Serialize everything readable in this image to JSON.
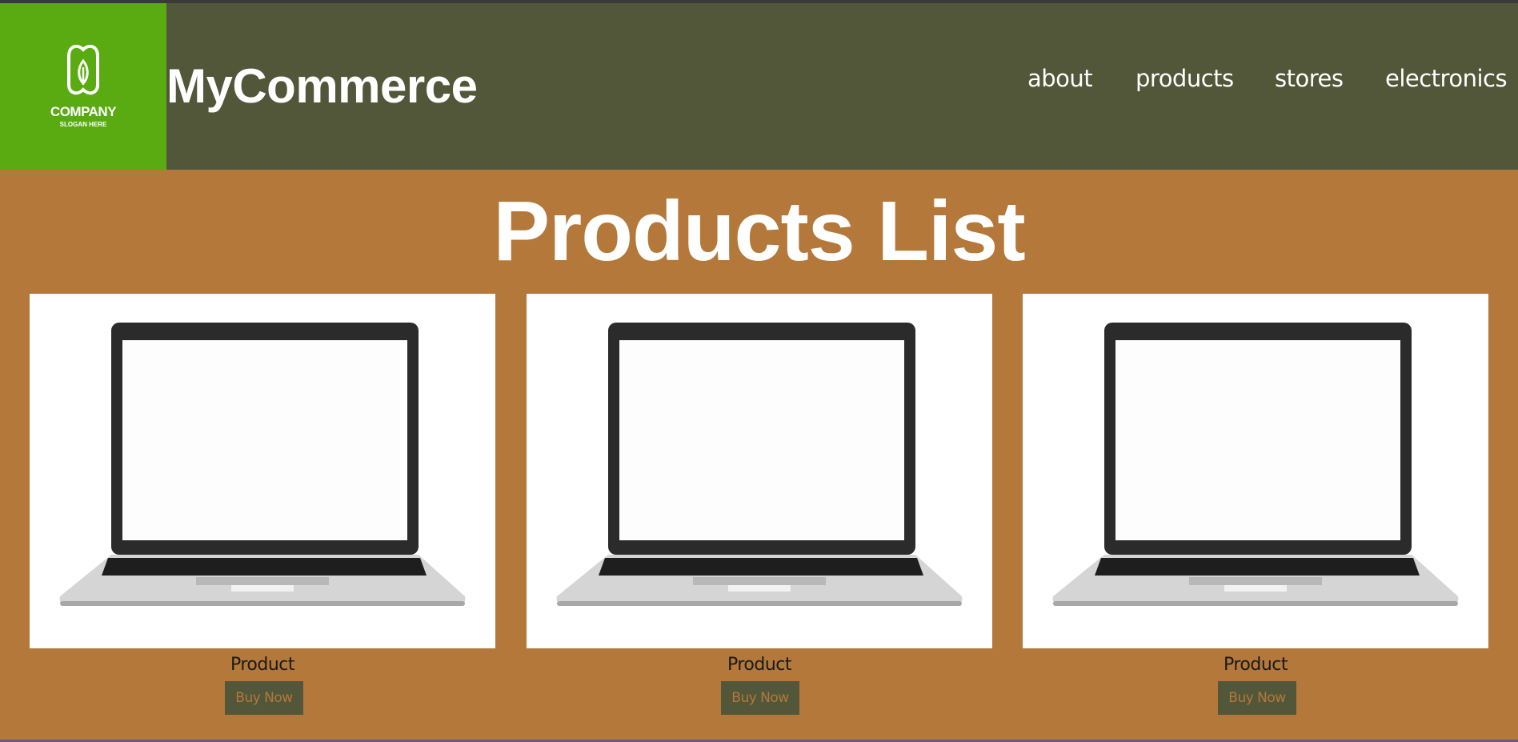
{
  "header": {
    "logo_company": "COMPANY",
    "logo_slogan": "SLOGAN HERE",
    "brand": "MyCommerce",
    "nav": [
      "about",
      "products",
      "stores",
      "electronics"
    ]
  },
  "main": {
    "title": "Products List",
    "products": [
      {
        "label": "Product",
        "button": "Buy Now"
      },
      {
        "label": "Product",
        "button": "Buy Now"
      },
      {
        "label": "Product",
        "button": "Buy Now"
      }
    ]
  },
  "colors": {
    "header_bg": "#52573a",
    "logo_bg": "#5aab11",
    "page_bg": "#b4783a",
    "button_bg": "#52573a"
  },
  "icons": [
    "leaf-logo-icon",
    "laptop-image"
  ]
}
